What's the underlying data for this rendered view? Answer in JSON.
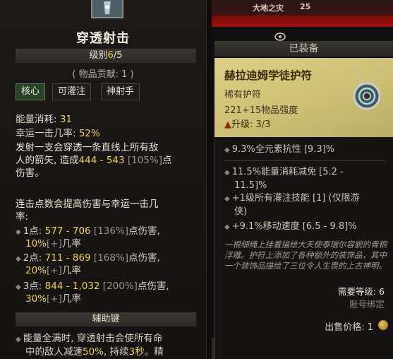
{
  "skill": {
    "title": "穿透射击",
    "level_label": "级别",
    "level_current": "6",
    "level_max": "/5",
    "contribution": "( 物品贡献: 1 )",
    "tags": [
      "核心",
      "可灌注",
      "神射手"
    ],
    "energy_cost_label": "能量消耗: ",
    "energy_cost_value": "31",
    "lucky_hit_label": "幸运一击几率: ",
    "lucky_hit_value": "52%",
    "description_1": "发射一支会穿透一条直线上所有敌",
    "description_2_pre": "人的箭矢, 造成",
    "description_2_dmg": "444 - 543",
    "description_2_pct": " [105%]",
    "description_2_post": "点",
    "description_3": "伤害。",
    "combo_intro_1": "连击点数会提高伤害与幸运一击几",
    "combo_intro_2": "率:",
    "combo_points": [
      {
        "label": "1点: ",
        "damage": "577 - 706",
        "pct": " [136%]",
        "suffix": "点伤害,",
        "chance": "10%",
        "chance_tag": "[+]",
        "chance_suffix": "几率"
      },
      {
        "label": "2点: ",
        "damage": "711 - 869",
        "pct": " [168%]",
        "suffix": "点伤害,",
        "chance": "20%",
        "chance_tag": "[+]",
        "chance_suffix": "几率"
      },
      {
        "label": "3点: ",
        "damage": "844 - 1,032",
        "pct": " [200%]",
        "suffix": "点伤害,",
        "chance": "30%",
        "chance_tag": "[+]",
        "chance_suffix": "几率"
      }
    ],
    "aux_bar_label": "辅助键",
    "aux_line_1": "能量全满时, 穿透射击会使所有命",
    "aux_line_2_pre": "中的敌人减速",
    "aux_line_2_val1": "50%",
    "aux_line_2_mid": ", 持续",
    "aux_line_2_val2": "3秒",
    "aux_line_2_post": "。精"
  },
  "top_strip": {
    "tier_label": "大地之灾",
    "tier_num": "25"
  },
  "equipped_label": "已装备",
  "item": {
    "name": "赫拉迪姆学徒护符",
    "rarity": "稀有护符",
    "power": "221+15物品强度",
    "upgrade": "升级: 3/3",
    "affixes": {
      "implicit": "9.3%全元素抗性 [9.3]%",
      "a1_line1": "11.5%能量消耗减免 [5.2 -",
      "a1_line2": "11.5]%",
      "a2_line1": "+1级所有灌注技能 [1] (仅限游",
      "a2_line2": "侠)",
      "a3": "+9.1%移动速度 [6.5 - 9.8]%"
    },
    "flavor": "一根细绳上挂着描绘大天使泰瑞尔容貌的青铜浮雕。护符上添加了各种额外的装饰品，其中一个装饰品描绘了三位令人生畏的上古神明。",
    "required_level": "需要等级: 6",
    "bound": "账号绑定",
    "sell_label": "出售价格: ",
    "sell_value": "1"
  },
  "colors": {
    "legendary_header": "#d6c97e",
    "accent_yellow": "#f0d24c",
    "core_tag_green": "#2a4128",
    "top_red": "#a01010"
  }
}
